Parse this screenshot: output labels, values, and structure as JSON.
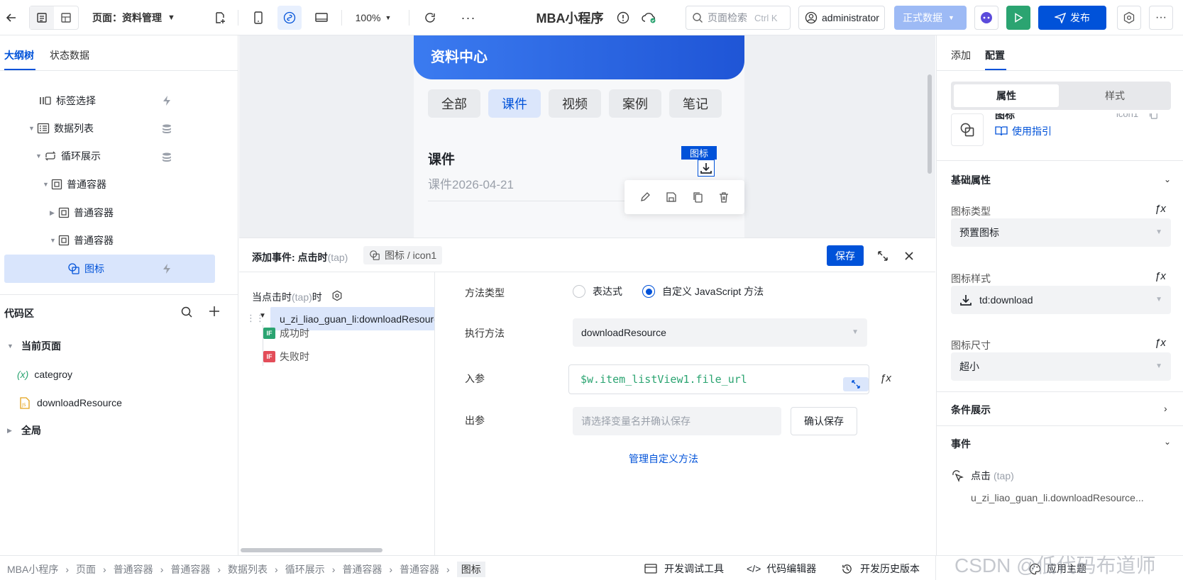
{
  "topbar": {
    "page_label": "页面：资料管理",
    "zoom": "100%",
    "app_title": "MBA小程序",
    "search_placeholder": "页面检索",
    "search_shortcut": "Ctrl K",
    "user": "administrator",
    "env_label": "正式数据",
    "publish_label": "发布"
  },
  "left": {
    "tabs": [
      "大纲树",
      "状态数据"
    ],
    "tree": [
      {
        "label": "标签选择",
        "level": 1
      },
      {
        "label": "数据列表",
        "level": 1
      },
      {
        "label": "循环展示",
        "level": 2
      },
      {
        "label": "普通容器",
        "level": 3
      },
      {
        "label": "普通容器",
        "level": 4
      },
      {
        "label": "普通容器",
        "level": 4
      },
      {
        "label": "图标",
        "level": 5
      }
    ],
    "code_title": "代码区",
    "current_page": "当前页面",
    "var_item": "categroy",
    "method_item": "downloadResource",
    "global": "全局"
  },
  "canvas": {
    "header_title": "资料中心",
    "tabs": [
      "全部",
      "课件",
      "视频",
      "案例",
      "笔记"
    ],
    "active_tab": "课件",
    "item_title": "课件",
    "item_subtitle": "课件2026-04-21",
    "icon_badge": "图标"
  },
  "event": {
    "title": "添加事件: 点击时",
    "title_tap": "(tap)",
    "target": "图标 / icon1",
    "save": "保存",
    "when_label": "当点击时",
    "when_tap": "(tap)",
    "when_suffix": "时",
    "action": "u_zi_liao_guan_li:downloadResource",
    "success": "成功时",
    "fail": "失败时",
    "if_badge": "IF",
    "method_type_label": "方法类型",
    "opt_expression": "表达式",
    "opt_custom": "自定义 JavaScript 方法",
    "exec_label": "执行方法",
    "exec_value": "downloadResource",
    "input_label": "入参",
    "input_value": "$w.item_listView1.file_url",
    "output_label": "出参",
    "output_placeholder": "请选择变量名并确认保存",
    "confirm_save": "确认保存",
    "manage_link": "管理自定义方法"
  },
  "right": {
    "tabs": [
      "添加",
      "配置"
    ],
    "seg": [
      "属性",
      "样式"
    ],
    "comp_name": "图标",
    "comp_id": "icon1",
    "guide": "使用指引",
    "basic": "基础属性",
    "icon_type_label": "图标类型",
    "icon_type_value": "预置图标",
    "icon_style_label": "图标样式",
    "icon_style_value": "td:download",
    "icon_size_label": "图标尺寸",
    "icon_size_value": "超小",
    "condition": "条件展示",
    "events": "事件",
    "tap_label": "点击",
    "tap_tag": "(tap)",
    "tap_value": "u_zi_liao_guan_li.downloadResource..."
  },
  "footer": {
    "crumbs": [
      "MBA小程序",
      "页面",
      "普通容器",
      "普通容器",
      "数据列表",
      "循环展示",
      "普通容器",
      "普通容器",
      "图标"
    ],
    "devtools": "开发调试工具",
    "code_editor": "代码编辑器",
    "history": "开发历史版本",
    "theme": "应用主题",
    "watermark": "CSDN @低代码布道师"
  },
  "colors": {
    "primary": "#0052d9",
    "accent_bg": "#e8f0fe",
    "success": "#2ba471",
    "error": "#e34d59"
  }
}
